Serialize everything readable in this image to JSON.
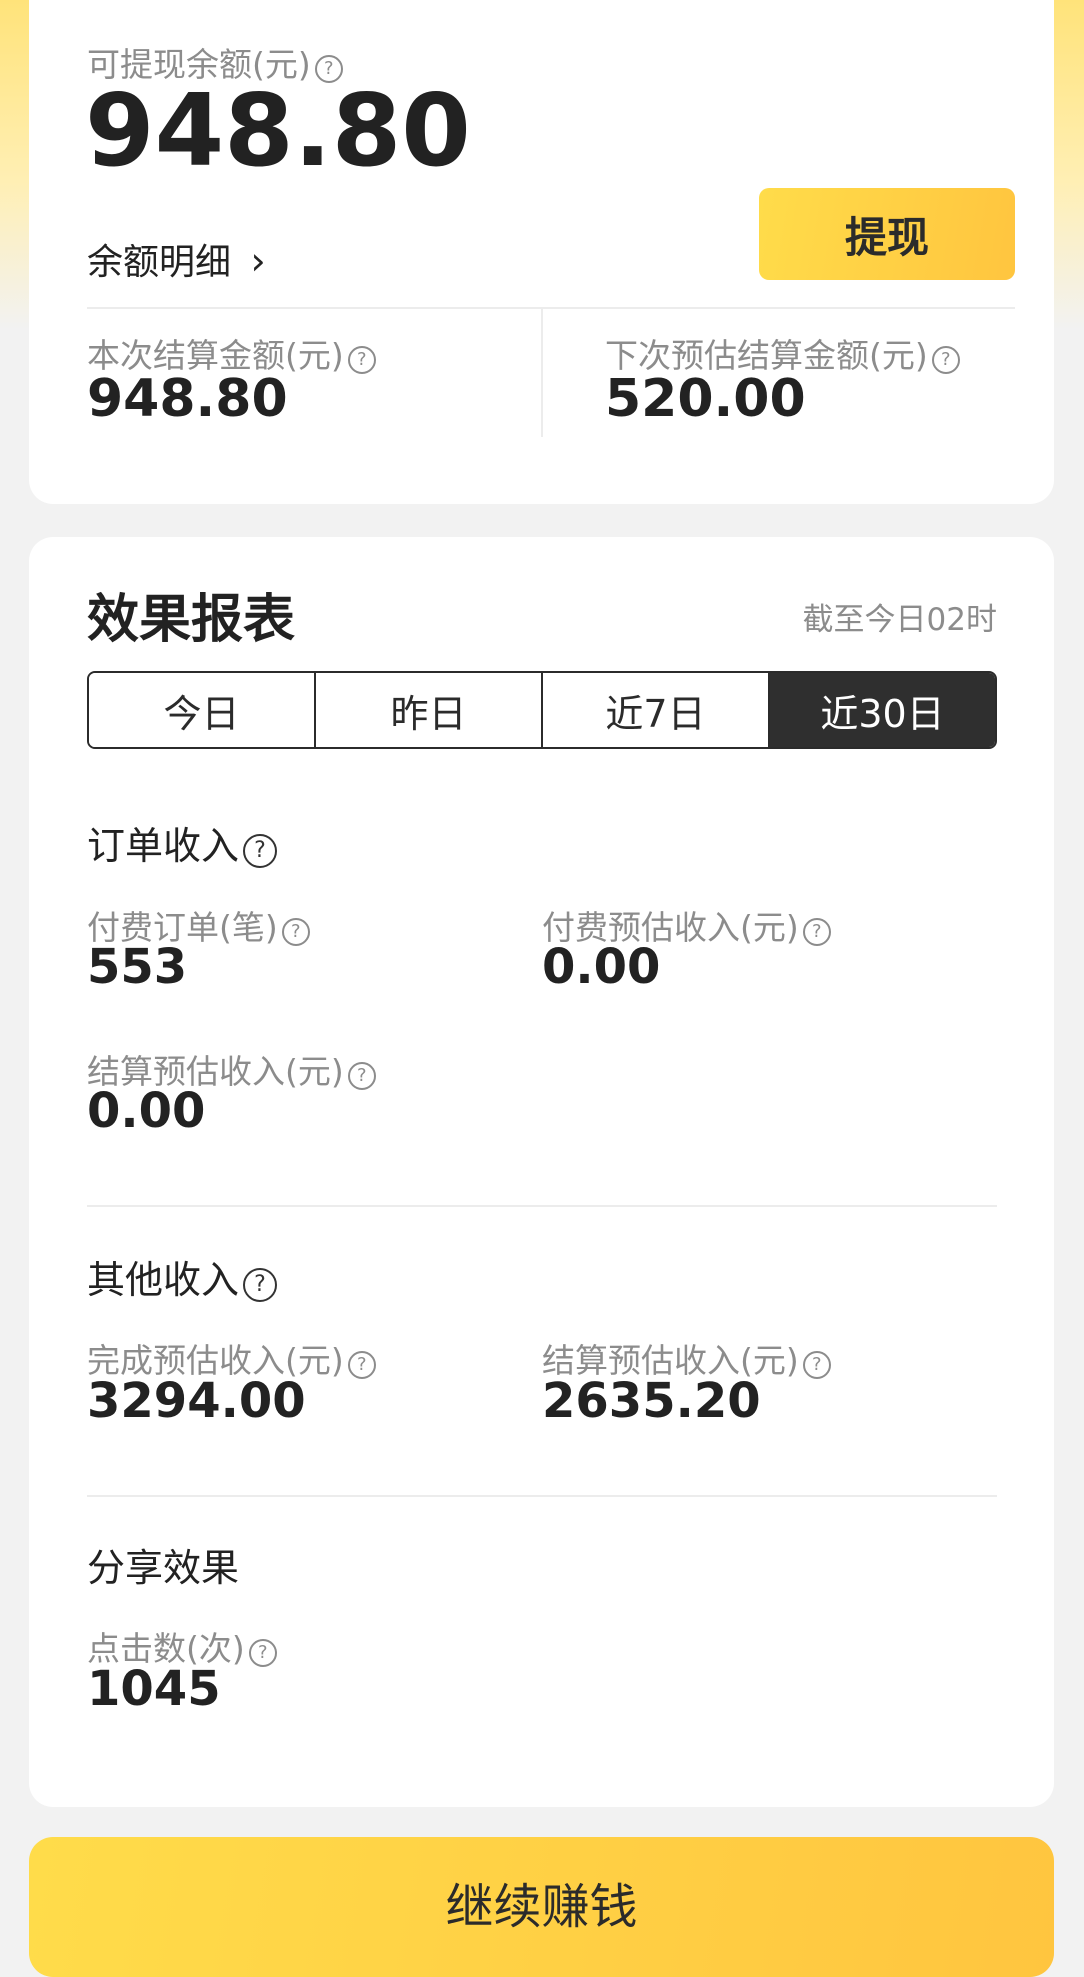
{
  "balance": {
    "available_label": "可提现余额(元)",
    "available_value": "948.80",
    "detail_link": "余额明细",
    "withdraw_button": "提现",
    "current_settle_label": "本次结算金额(元)",
    "current_settle_value": "948.80",
    "next_settle_label": "下次预估结算金额(元)",
    "next_settle_value": "520.00"
  },
  "report": {
    "title": "效果报表",
    "as_of": "截至今日02时",
    "tabs": [
      "今日",
      "昨日",
      "近7日",
      "近30日"
    ],
    "active_tab": "近30日",
    "order_income": {
      "title": "订单收入",
      "paid_orders_label": "付费订单(笔)",
      "paid_orders_value": "553",
      "paid_est_income_label": "付费预估收入(元)",
      "paid_est_income_value": "0.00",
      "settle_est_income_label": "结算预估收入(元)",
      "settle_est_income_value": "0.00"
    },
    "other_income": {
      "title": "其他收入",
      "complete_est_label": "完成预估收入(元)",
      "complete_est_value": "3294.00",
      "settle_est_label": "结算预估收入(元)",
      "settle_est_value": "2635.20"
    },
    "share": {
      "title": "分享效果",
      "clicks_label": "点击数(次)",
      "clicks_value": "1045"
    }
  },
  "footer": {
    "continue_button": "继续赚钱"
  },
  "icons": {
    "help": "?",
    "chevron": "›"
  },
  "colors": {
    "accent_yellow": "#ffd54a",
    "active_tab_bg": "#2f2f2f"
  }
}
